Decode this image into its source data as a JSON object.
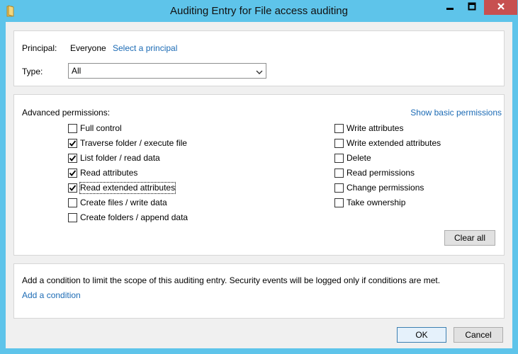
{
  "window": {
    "title": "Auditing Entry for File access auditing",
    "icons": {
      "app": "folder-icon",
      "minimize": "minimize-icon",
      "maximize": "maximize-icon",
      "close": "close-icon"
    }
  },
  "principal": {
    "label": "Principal:",
    "value": "Everyone",
    "select_link": "Select a principal"
  },
  "type": {
    "label": "Type:",
    "selected": "All"
  },
  "permissions": {
    "heading": "Advanced permissions:",
    "show_basic_link": "Show basic permissions",
    "left": [
      {
        "label": "Full control",
        "checked": false
      },
      {
        "label": "Traverse folder / execute file",
        "checked": true
      },
      {
        "label": "List folder / read data",
        "checked": true
      },
      {
        "label": "Read attributes",
        "checked": true
      },
      {
        "label": "Read extended attributes",
        "checked": true
      },
      {
        "label": "Create files / write data",
        "checked": false
      },
      {
        "label": "Create folders / append data",
        "checked": false
      }
    ],
    "right": [
      {
        "label": "Write attributes",
        "checked": false
      },
      {
        "label": "Write extended attributes",
        "checked": false
      },
      {
        "label": "Delete",
        "checked": false
      },
      {
        "label": "Read permissions",
        "checked": false
      },
      {
        "label": "Change permissions",
        "checked": false
      },
      {
        "label": "Take ownership",
        "checked": false
      }
    ],
    "clear_all": "Clear all"
  },
  "condition": {
    "text": "Add a condition to limit the scope of this auditing entry. Security events will be logged only if conditions are met.",
    "add_link": "Add a condition"
  },
  "footer": {
    "ok": "OK",
    "cancel": "Cancel"
  },
  "colors": {
    "titlebar": "#5ec4ea",
    "close_button": "#c75050",
    "link": "#1c6bb5",
    "dialog_bg": "#f0f0f0"
  }
}
